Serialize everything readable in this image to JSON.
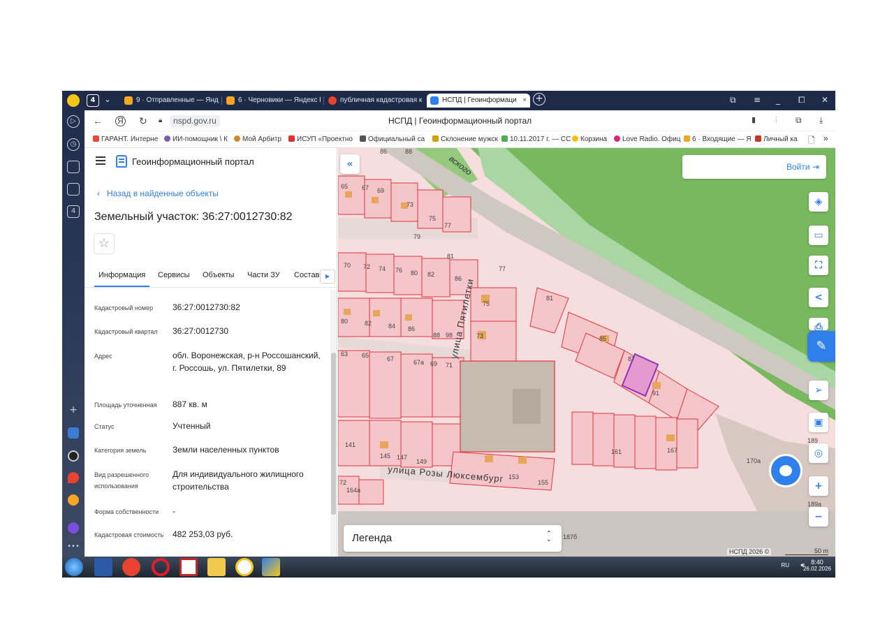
{
  "browser": {
    "tab_count": "4",
    "tabs": [
      {
        "label": "9 · Отправленные — Янде",
        "icon_color": "#f5a623"
      },
      {
        "label": "6 · Черновики — Яндекс П",
        "icon_color": "#f5a623"
      },
      {
        "label": "публичная кадастровая к",
        "icon_color": "#e8432e"
      },
      {
        "label": "НСПД | Геоинформаци",
        "icon_color": "#2f80ed",
        "active": true
      }
    ],
    "new_tab": "+",
    "url": "nspd.gov.ru",
    "page_title": "НСПД | Геоинформационный портал",
    "bookmarks": [
      {
        "label": "ГАРАНТ. Интерне",
        "color": "#e84a3c"
      },
      {
        "label": "ИИ-помощник \\ К",
        "color": "#7b5ea7"
      },
      {
        "label": "Мой Арбитр",
        "color": "#d08a2a"
      },
      {
        "label": "ИСУП «Проектно",
        "color": "#e03030"
      },
      {
        "label": "Официальный са",
        "color": "#555555"
      },
      {
        "label": "Склонение мужск",
        "color": "#d0a000"
      },
      {
        "label": "10.11.2017 г. — СС",
        "color": "#4caf50"
      },
      {
        "label": "Корзина",
        "color": "#f4c20d"
      },
      {
        "label": "Love Radio. Офиц",
        "color": "#e0247a"
      },
      {
        "label": "6 · Входящие — Я",
        "color": "#f5a623"
      },
      {
        "label": "Личный ка",
        "color": "#c0392b"
      }
    ],
    "bookmarks_more": "»"
  },
  "panel": {
    "portal_name": "Геоинформационный портал",
    "back_link": "Назад в найденные объекты",
    "title": "Земельный участок: 36:27:0012730:82",
    "tabs": [
      "Информация",
      "Сервисы",
      "Объекты",
      "Части ЗУ",
      "Состав"
    ],
    "properties": [
      {
        "label": "Кадастровый номер",
        "value": "36:27:0012730:82"
      },
      {
        "label": "Кадастровый квартал",
        "value": "36:27:0012730"
      },
      {
        "label": "Адрес",
        "value": "обл. Воронежская, р-н Россошанский, г. Россошь, ул. Пятилетки, 89"
      },
      {
        "label": "Площадь уточненная",
        "value": "887 кв. м"
      },
      {
        "label": "Статус",
        "value": "Учтенный"
      },
      {
        "label": "Категория земель",
        "value": "Земли населенных пунктов"
      },
      {
        "label": "Вид разрешенного использования",
        "value": "Для индивидуального жилищного строительства"
      },
      {
        "label": "Форма собственности",
        "value": "-"
      },
      {
        "label": "Кадастровая стоимость",
        "value": "482 253,03 руб."
      }
    ]
  },
  "map": {
    "login": "Войти",
    "legend": "Легенда",
    "copyright": "НСПД 2026 ©",
    "scale": "50 m",
    "streets": [
      "улица Пятилетки",
      "улица Розы Люксембург",
      "вского"
    ],
    "plot_numbers": [
      "65",
      "67",
      "69",
      "73",
      "75",
      "77",
      "79",
      "81",
      "70",
      "72",
      "74",
      "76",
      "80",
      "82",
      "86",
      "77",
      "75",
      "81",
      "80",
      "82",
      "84",
      "86",
      "88",
      "98",
      "73",
      "85",
      "87",
      "91",
      "63",
      "65",
      "67",
      "67а",
      "69",
      "71",
      "141",
      "145",
      "147",
      "149",
      "153",
      "155",
      "161",
      "167",
      "164а",
      "170а",
      "189",
      "189а",
      "187б",
      "72",
      "86",
      "88"
    ]
  },
  "system": {
    "lang": "RU",
    "time": "8:40",
    "date": "26.02.2026"
  },
  "colors": {
    "parcel_fill": "#f5c6c9",
    "parcel_stroke": "#e0343f",
    "selected_parcel": "#e39ad0",
    "park": "#78b85e",
    "road": "#c9c3bd",
    "accent": "#2f80ed"
  }
}
